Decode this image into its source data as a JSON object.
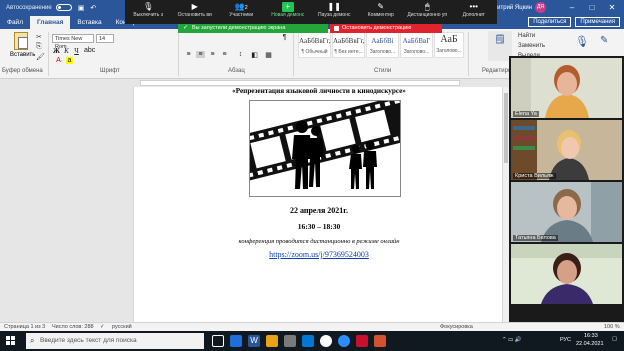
{
  "titlebar": {
    "autosave": "Автосохранение",
    "user": "Дмитрий Яцкин",
    "avatar": "ДЯ",
    "min": "–",
    "max": "□",
    "close": "✕"
  },
  "tabs": [
    "Файл",
    "Главная",
    "Вставка",
    "Констр"
  ],
  "tabs_right": {
    "share": "Поделиться",
    "comments": "Примечания"
  },
  "zoom": {
    "items": [
      "Выключить з",
      "Остановить ви",
      "Участники",
      "Новая демонс",
      "Пауза демонс",
      "Комментир",
      "Дистанционно уп",
      "Дополнит"
    ],
    "participants_count": "2",
    "share_banner": "Вы запустили демонстрацию экрана",
    "stop_banner": "Остановить демонстрацию"
  },
  "ribbon": {
    "paste": "Вставить",
    "font_name": "Times New Rom",
    "font_size": "14",
    "group_clipboard": "Буфер обмена",
    "group_font": "Шрифт",
    "group_paragraph": "Абзац",
    "group_styles": "Стили",
    "group_editing": "Редактиров",
    "styles": [
      {
        "sample": "АаБбВвГг,",
        "name": "¶ Обычный"
      },
      {
        "sample": "АаБбВвГг,",
        "name": "¶ Без инте..."
      },
      {
        "sample": "АаБбВі",
        "name": "Заголово..."
      },
      {
        "sample": "АаБбВвГ",
        "name": "Заголово..."
      },
      {
        "sample": "АаБ",
        "name": "Заголово..."
      }
    ],
    "right": [
      "Найти",
      "Заменить",
      "Выдели"
    ]
  },
  "document": {
    "title": "«Репрезентация языковой личности в кинодискурсе»",
    "date": "22 апреля 2021г.",
    "time": "16:30 – 18:30",
    "note": "конференция проводится дистанционно в режиме онлайн",
    "link": "https://zoom.us/j/97369524003"
  },
  "videos": [
    {
      "name": "Elena Ya"
    },
    {
      "name": "Криста Вильяж"
    },
    {
      "name": "Татьяна Белова"
    },
    {
      "name": ""
    }
  ],
  "statusbar": {
    "page": "Страница 1 из 3",
    "words": "Число слов: 288",
    "lang": "русский",
    "focus": "Фокусировка",
    "zoom": "100 %"
  },
  "taskbar": {
    "search_placeholder": "Введите здесь текст для поиска",
    "time": "16:33",
    "date": "22.04.2021",
    "lang": "РУС"
  }
}
